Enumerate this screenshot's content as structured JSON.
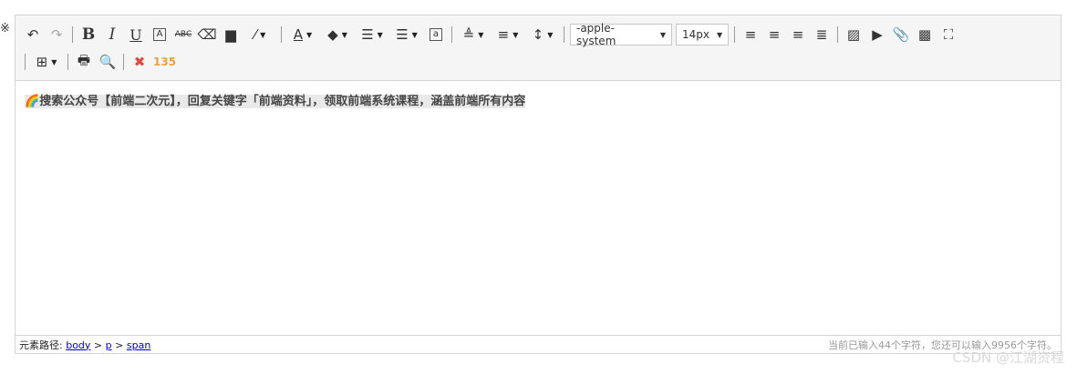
{
  "left_clip_text": "※",
  "toolbar": {
    "font_family": "-apple-system",
    "font_size": "14px",
    "caret": "▼"
  },
  "content": {
    "emoji": "🌈",
    "text": "搜索公众号【前端二次元】，回复关键字「前端资料」，领取前端系统课程，涵盖前端所有内容"
  },
  "statusbar": {
    "path_label": "元素路径:",
    "path": [
      "body",
      "p",
      "span"
    ],
    "separator": " > ",
    "count_text": "当前已输入44个字符，您还可以输入9956个字符。"
  },
  "watermark": "CSDN @江湖资程"
}
